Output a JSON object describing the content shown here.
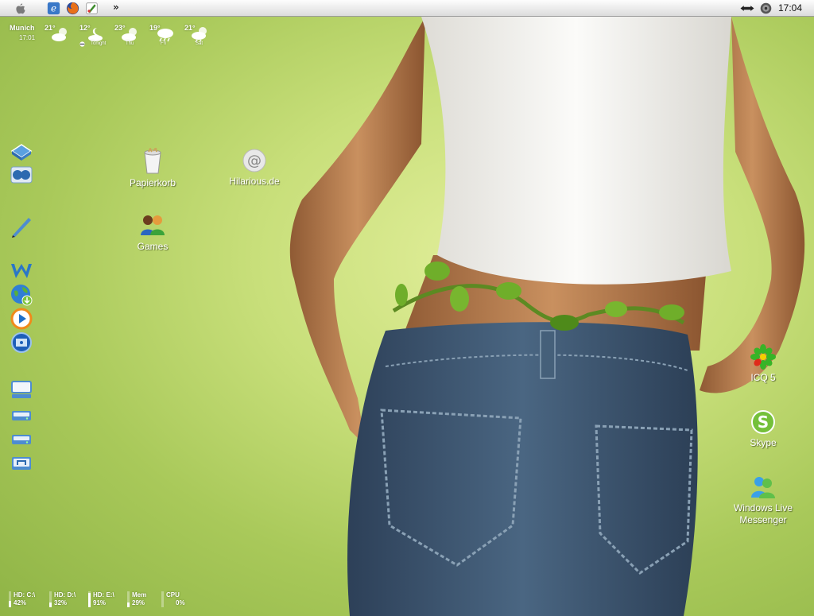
{
  "menubar": {
    "apple_icon": "apple-icon",
    "apps": [
      {
        "name": "internet-explorer",
        "icon": "ie-icon"
      },
      {
        "name": "firefox",
        "icon": "firefox-icon"
      },
      {
        "name": "paint",
        "icon": "paint-icon"
      }
    ],
    "overflow": "»",
    "status_icons": [
      "network-icon",
      "volume-icon"
    ],
    "clock": "17:04"
  },
  "weather": {
    "city": "Munich",
    "time": "17:01",
    "forecast": [
      {
        "temp": "21°",
        "day": "",
        "icon": "partly-cloudy-icon"
      },
      {
        "temp": "12°",
        "day": "Tonight",
        "icon": "moon-cloud-icon"
      },
      {
        "temp": "23°",
        "day": "Thu",
        "icon": "partly-cloudy-icon"
      },
      {
        "temp": "19°",
        "day": "Fri",
        "icon": "rain-cloud-icon"
      },
      {
        "temp": "21°",
        "day": "Sat",
        "icon": "partly-cloudy-rain-icon"
      }
    ]
  },
  "dock": [
    {
      "name": "dock-finder",
      "icon": "finder-icon"
    },
    {
      "name": "dock-dashboard",
      "icon": "dashboard-icon"
    },
    {
      "name": "dock-pen",
      "icon": "pen-icon"
    },
    {
      "name": "dock-winamp",
      "icon": "winamp-icon"
    },
    {
      "name": "dock-globe",
      "icon": "globe-download-icon"
    },
    {
      "name": "dock-media-player",
      "icon": "media-player-icon"
    },
    {
      "name": "dock-dvd",
      "icon": "dvd-icon"
    },
    {
      "name": "dock-computer",
      "icon": "computer-icon"
    },
    {
      "name": "dock-drive-c",
      "icon": "drive-icon"
    },
    {
      "name": "dock-drive-d",
      "icon": "drive-icon"
    },
    {
      "name": "dock-network-drive",
      "icon": "network-drive-icon"
    }
  ],
  "desktop": {
    "papierkorb": "Papierkorb",
    "hilarious": "Hilarious.de",
    "games": "Games",
    "icq": "ICQ 5",
    "skype": "Skype",
    "messenger_line1": "Windows Live",
    "messenger_line2": "Messenger"
  },
  "meters": [
    {
      "label": "HD: C:\\",
      "value": "42%",
      "fraction": 0.42
    },
    {
      "label": "HD: D:\\",
      "value": "32%",
      "fraction": 0.32
    },
    {
      "label": "HD: E:\\",
      "value": "91%",
      "fraction": 0.91
    },
    {
      "label": "Mem",
      "value": "29%",
      "fraction": 0.29
    },
    {
      "label": "CPU",
      "value": "0%",
      "fraction": 0.0
    }
  ],
  "colors": {
    "desktop_bg": "#b8d56a",
    "menubar_bg": "#e8e8e8",
    "jeans": "#3e5670",
    "shirt": "#f4f4f2",
    "skin": "#c08356"
  }
}
